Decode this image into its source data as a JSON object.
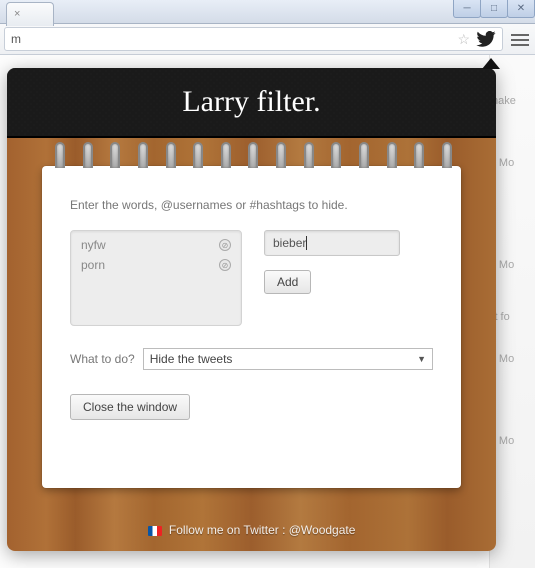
{
  "browser": {
    "addr_left": "m",
    "extension_tooltip": ""
  },
  "popup": {
    "title": "Larry filter.",
    "prompt": "Enter the words, @usernames or #hashtags to hide.",
    "filters": [
      {
        "word": "nyfw"
      },
      {
        "word": "porn"
      }
    ],
    "input_value": "bieber",
    "add_label": "Add",
    "action_label": "What to do?",
    "action_selected": "Hide the tweets",
    "close_label": "Close the window",
    "footer_text": "Follow me on Twitter : @Woodgate"
  },
  "side": {
    "frag1": "nake",
    "frag2": "• Mo",
    "frag3": "• Mo",
    "frag4": "it fo",
    "frag5": "• Mo",
    "frag6": "• Mo"
  }
}
